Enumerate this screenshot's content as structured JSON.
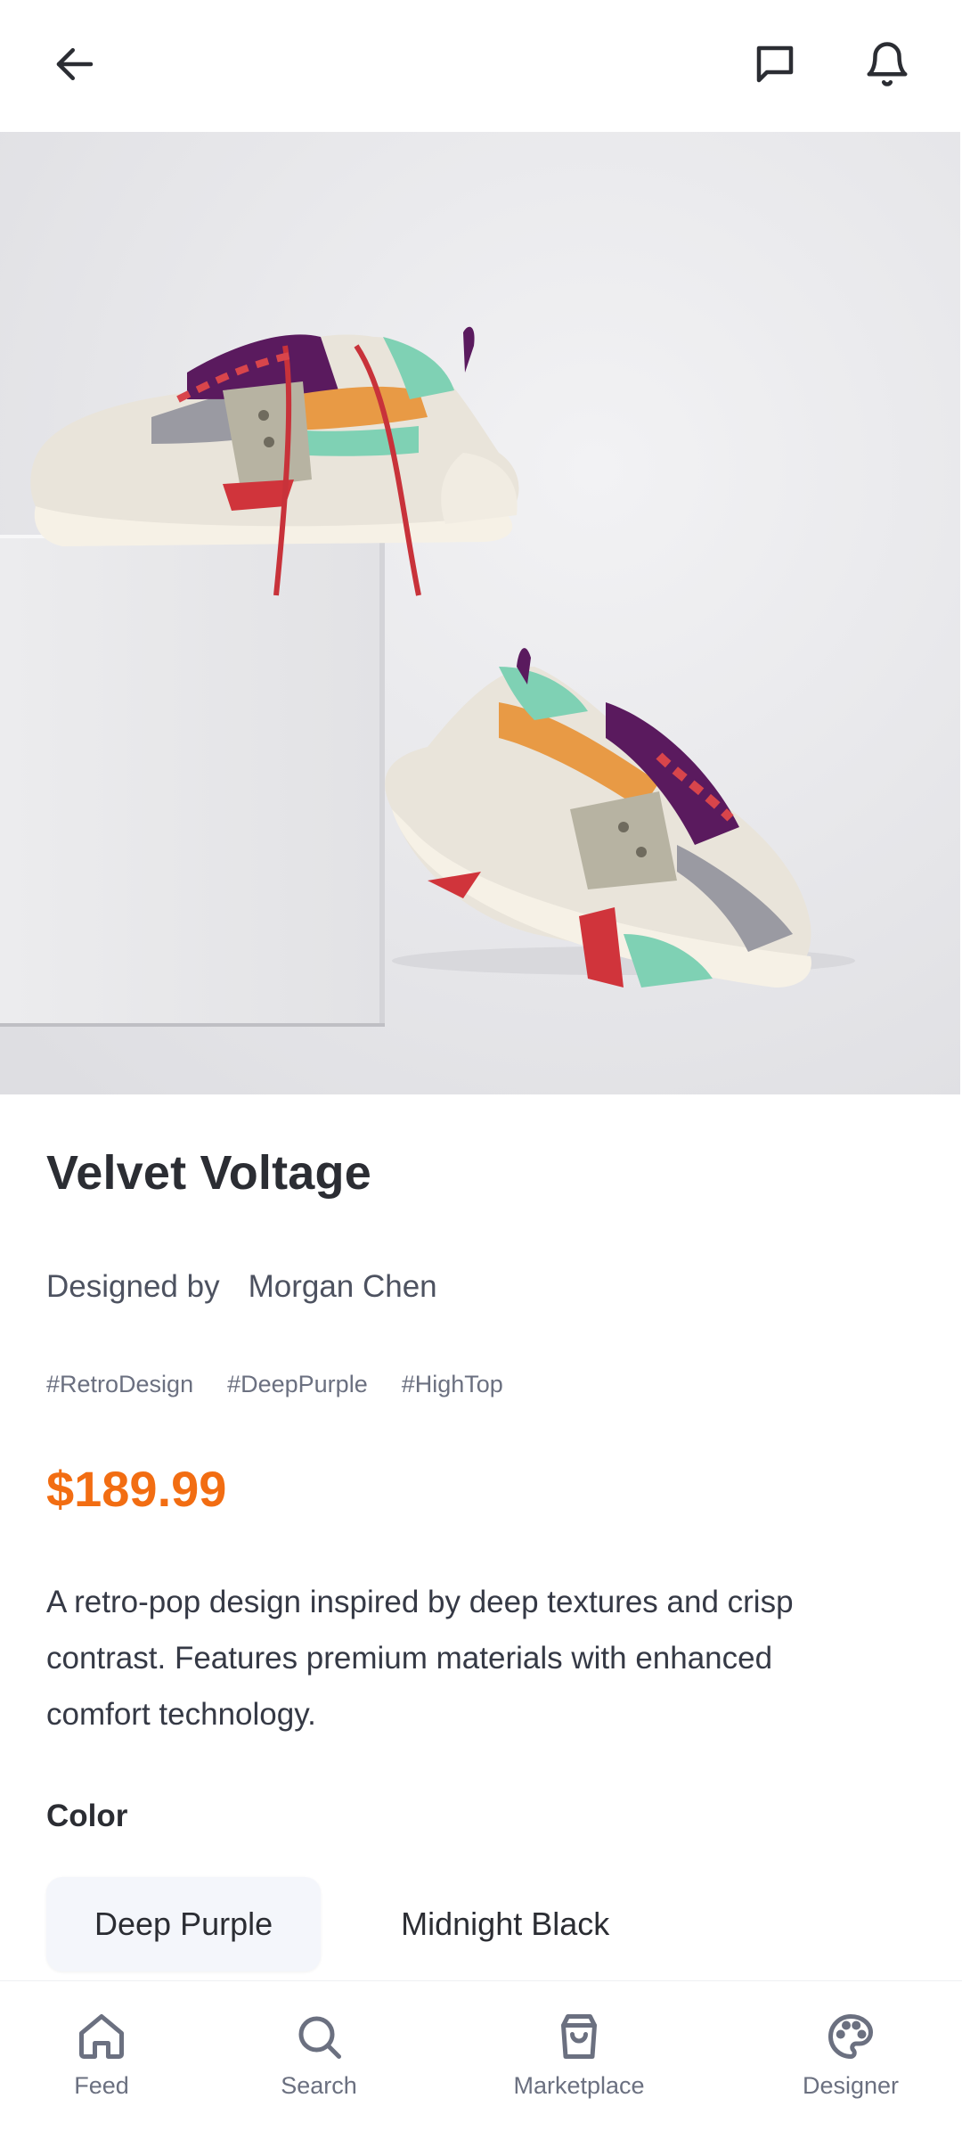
{
  "header": {
    "back_icon": "arrow-left-icon",
    "message_icon": "chat-bubble-icon",
    "notification_icon": "bell-icon"
  },
  "product": {
    "title": "Velvet Voltage",
    "designed_by_label": "Designed by",
    "designer_name": "Morgan Chen",
    "tags": [
      "#RetroDesign",
      "#DeepPurple",
      "#HighTop"
    ],
    "price": "$189.99",
    "description": "A retro-pop design inspired by deep textures and crisp contrast. Features premium materials with enhanced comfort technology.",
    "color_label": "Color",
    "colors": [
      {
        "label": "Deep Purple",
        "selected": true
      },
      {
        "label": "Midnight Black",
        "selected": false
      }
    ],
    "accent_color": "#f26d12"
  },
  "bottom_nav": {
    "items": [
      {
        "label": "Feed",
        "icon": "home-icon"
      },
      {
        "label": "Search",
        "icon": "search-icon"
      },
      {
        "label": "Marketplace",
        "icon": "shopping-bag-icon"
      },
      {
        "label": "Designer",
        "icon": "palette-icon"
      }
    ]
  }
}
